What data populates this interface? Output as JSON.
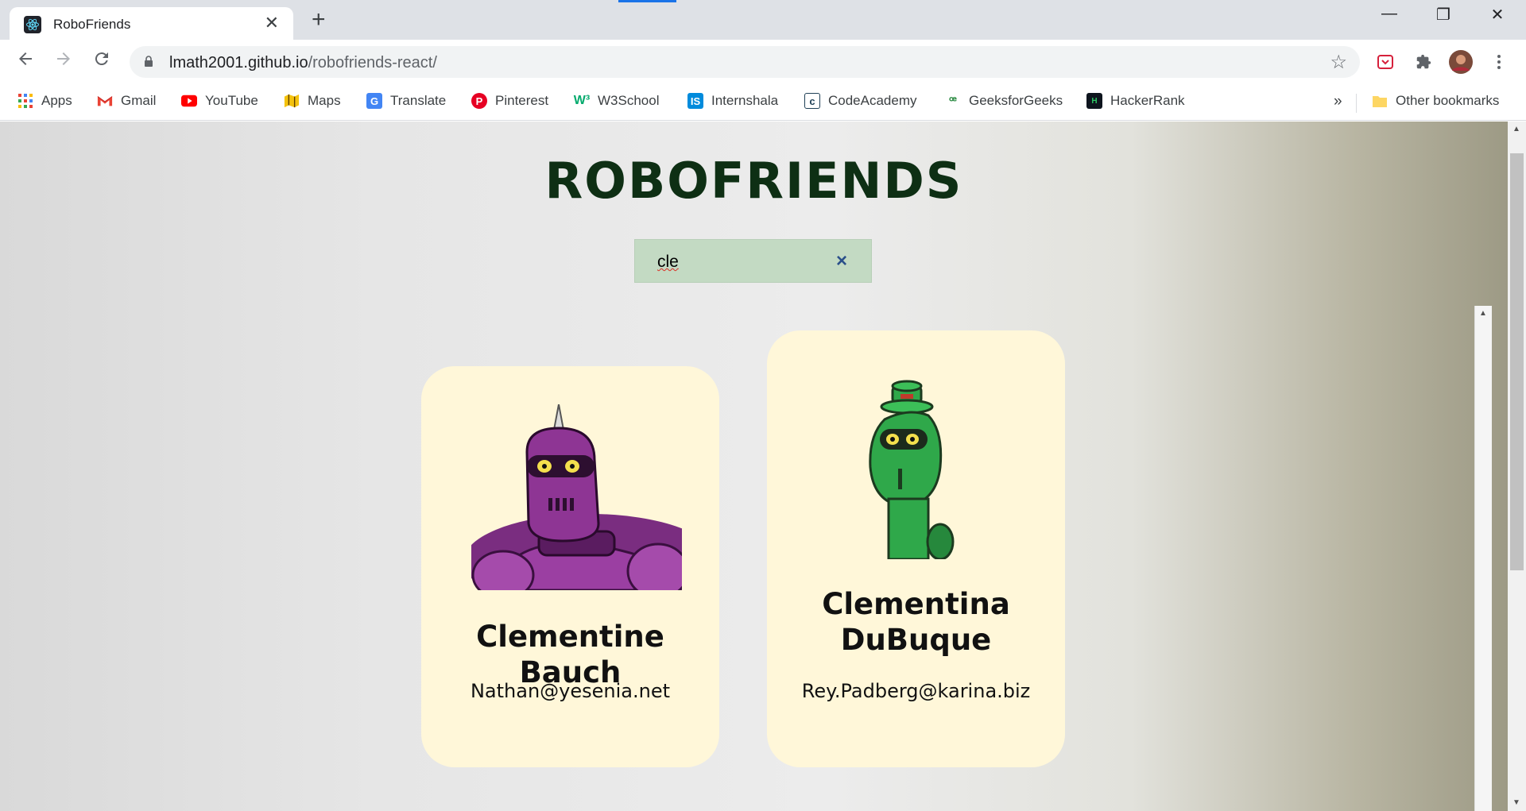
{
  "browser": {
    "tab_title": "RoboFriends",
    "tab_close": "✕",
    "new_tab": "+",
    "window_controls": {
      "minimize": "—",
      "restore": "❐",
      "close": "✕"
    },
    "url_host": "lmath2001.github.io",
    "url_path": "/robofriends-react/",
    "bookmarks": [
      {
        "label": "Apps",
        "icon": "apps-grid-icon"
      },
      {
        "label": "Gmail",
        "icon": "gmail-icon"
      },
      {
        "label": "YouTube",
        "icon": "youtube-icon"
      },
      {
        "label": "Maps",
        "icon": "maps-icon"
      },
      {
        "label": "Translate",
        "icon": "translate-icon"
      },
      {
        "label": "Pinterest",
        "icon": "pinterest-icon"
      },
      {
        "label": "W3School",
        "icon": "w3schools-icon"
      },
      {
        "label": "Internshala",
        "icon": "internshala-icon"
      },
      {
        "label": "CodeAcademy",
        "icon": "codecademy-icon"
      },
      {
        "label": "GeeksforGeeks",
        "icon": "geeksforgeeks-icon"
      },
      {
        "label": "HackerRank",
        "icon": "hackerrank-icon"
      }
    ],
    "overflow": "»",
    "other_bookmarks": "Other bookmarks"
  },
  "page": {
    "title": "ROBOFRIENDS",
    "search": {
      "value": "cle",
      "clear": "×"
    },
    "robots": [
      {
        "name": "Clementine Bauch",
        "email": "Nathan@yesenia.net",
        "color": "#8e3594"
      },
      {
        "name": "Clementina DuBuque",
        "email": "Rey.Padberg@karina.biz",
        "color": "#2fa84a"
      }
    ]
  },
  "colors": {
    "title": "#0e2f14",
    "card_bg": "#fff7d9",
    "search_bg": "#c3dac3"
  }
}
